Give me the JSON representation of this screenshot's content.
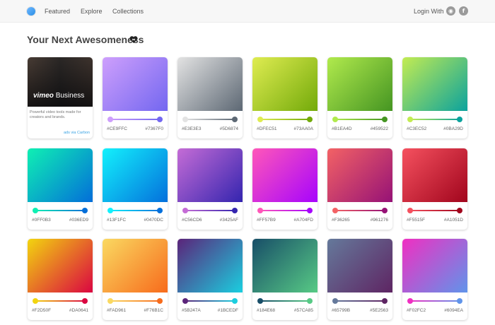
{
  "nav": {
    "items": [
      "Featured",
      "Explore",
      "Collections"
    ],
    "login_text": "Login With"
  },
  "page": {
    "title": "Your Next Awesomeness"
  },
  "ad": {
    "brand_prefix": "vimeo",
    "brand_suffix": "Business",
    "text": "Powerful video tools made for creators and brands.",
    "via": "ads via Carbon"
  },
  "gradients": [
    {
      "from": "#CE9FFC",
      "to": "#7367F0"
    },
    {
      "from": "#E3E3E3",
      "to": "#5D6874"
    },
    {
      "from": "#DFEC51",
      "to": "#73AA0A"
    },
    {
      "from": "#B1EA4D",
      "to": "#459522"
    },
    {
      "from": "#C3EC52",
      "to": "#0BA29D"
    },
    {
      "from": "#0FF0B3",
      "to": "#036ED9"
    },
    {
      "from": "#13F1FC",
      "to": "#0470DC"
    },
    {
      "from": "#C56CD6",
      "to": "#3425AF"
    },
    {
      "from": "#FF57B9",
      "to": "#A704FD"
    },
    {
      "from": "#F36265",
      "to": "#961276"
    },
    {
      "from": "#F5515F",
      "to": "#A1051D"
    },
    {
      "from": "#F2D50F",
      "to": "#DA0641"
    },
    {
      "from": "#FAD961",
      "to": "#F76B1C"
    },
    {
      "from": "#5B247A",
      "to": "#1BCEDF"
    },
    {
      "from": "#184E68",
      "to": "#57CA85"
    },
    {
      "from": "#65799B",
      "to": "#5E2563"
    },
    {
      "from": "#F02FC2",
      "to": "#6094EA"
    }
  ]
}
